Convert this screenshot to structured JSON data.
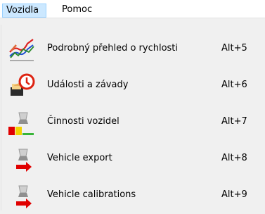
{
  "menubar": {
    "items": [
      {
        "label": "Vozidla",
        "active": true
      },
      {
        "label": "Pomoc",
        "active": false
      }
    ]
  },
  "menu": {
    "items": [
      {
        "label": "Podrobný přehled o rychlosti",
        "shortcut": "Alt+5",
        "icon": "speed-chart-icon"
      },
      {
        "label": "Události a závady",
        "shortcut": "Alt+6",
        "icon": "vehicle-alarm-icon"
      },
      {
        "label": "Činnosti vozidel",
        "shortcut": "Alt+7",
        "icon": "vehicle-activity-icon"
      },
      {
        "label": "Vehicle export",
        "shortcut": "Alt+8",
        "icon": "vehicle-export-icon"
      },
      {
        "label": "Vehicle calibrations",
        "shortcut": "Alt+9",
        "icon": "vehicle-calibration-icon"
      }
    ]
  }
}
